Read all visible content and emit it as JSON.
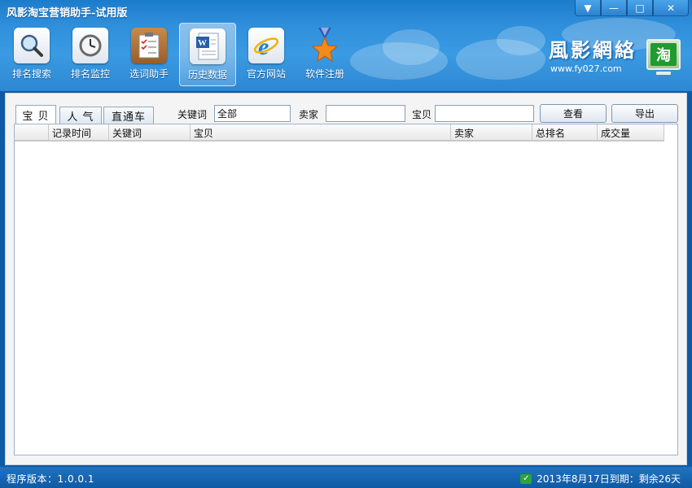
{
  "app": {
    "title": "风影淘宝营销助手-试用版"
  },
  "toolbar": {
    "items": [
      {
        "label": "排名搜索",
        "icon": "magnifier-icon",
        "active": false
      },
      {
        "label": "排名监控",
        "icon": "clock-icon",
        "active": false
      },
      {
        "label": "选词助手",
        "icon": "clipboard-checklist-icon",
        "active": false
      },
      {
        "label": "历史数据",
        "icon": "word-document-icon",
        "active": true
      },
      {
        "label": "官方网站",
        "icon": "ie-browser-icon",
        "active": false
      },
      {
        "label": "软件注册",
        "icon": "medal-star-icon",
        "active": false
      }
    ]
  },
  "brand": {
    "name": "風影網絡",
    "url": "www.fy027.com",
    "logo_text": "淘"
  },
  "tabs": [
    {
      "label": "宝 贝",
      "active": true
    },
    {
      "label": "人 气",
      "active": false
    },
    {
      "label": "直通车",
      "active": false
    }
  ],
  "filters": {
    "keyword_label": "关键词",
    "keyword_value": "全部",
    "seller_label": "卖家",
    "seller_value": "",
    "item_label": "宝贝",
    "item_value": "",
    "view_button": "查看",
    "export_button": "导出"
  },
  "grid": {
    "columns": [
      "记录时间",
      "关键词",
      "宝贝",
      "卖家",
      "总排名",
      "成交量"
    ],
    "rows": []
  },
  "status": {
    "version": "程序版本：1.0.0.1",
    "expiry": "2013年8月17日到期：剩余26天"
  },
  "colors": {
    "header_blue": "#2f8fdb",
    "status_blue": "#0f5aa4",
    "logo_green": "#1f9b2f"
  }
}
